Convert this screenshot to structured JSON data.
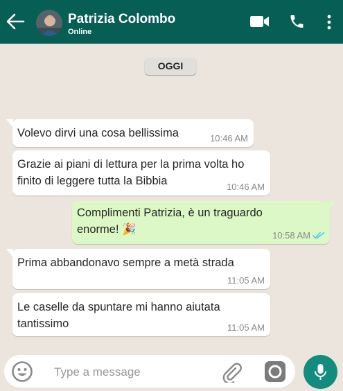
{
  "header": {
    "contact_name": "Patrizia Colombo",
    "status": "Online",
    "colors": {
      "bar": "#075e54",
      "accent": "#128c7e"
    },
    "icons": [
      "back-arrow-icon",
      "video-call-icon",
      "phone-icon",
      "more-options-icon"
    ]
  },
  "chat": {
    "date_label": "OGGI",
    "messages": [
      {
        "direction": "in",
        "text": "Volevo dirvi una cosa bellissima",
        "time": "10:46 AM"
      },
      {
        "direction": "in",
        "text": "Grazie ai piani di lettura per la prima volta ho finito di leggere tutta la Bibbia",
        "time": "10:46 AM"
      },
      {
        "direction": "out",
        "text": "Complimenti Patrizia, è un traguardo enorme! 🎉",
        "time": "10:58 AM",
        "status": "read"
      },
      {
        "direction": "in",
        "text": "Prima abbandonavo sempre a metà strada",
        "time": "11:05 AM"
      },
      {
        "direction": "in",
        "text": "Le caselle da spuntare mi hanno aiutata tantissimo",
        "time": "11:05 AM"
      }
    ],
    "colors": {
      "background": "#ece5dd",
      "incoming": "#ffffff",
      "outgoing": "#dcf8c6",
      "read_ticks": "#4fc3f7"
    }
  },
  "input": {
    "placeholder": "Type a message",
    "value": "",
    "icons": [
      "emoji-icon",
      "attach-icon",
      "camera-icon",
      "mic-icon"
    ]
  }
}
